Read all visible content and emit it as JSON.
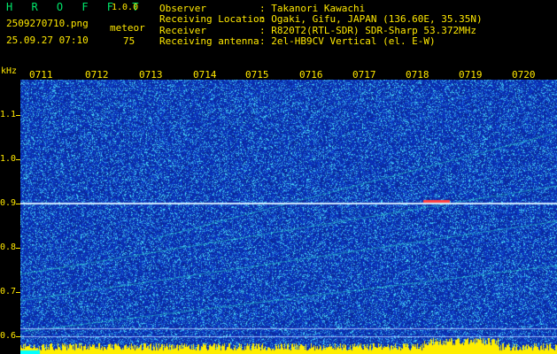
{
  "header": {
    "logo": "H R O F F T",
    "version": "1.0.0",
    "filename": "2509270710.png",
    "datetime": "25.09.27 07:10",
    "meteor_label": "meteor",
    "meteor_count": "75"
  },
  "info": [
    {
      "key": "Observer",
      "value": ": Takanori Kawachi"
    },
    {
      "key": "Receiving Location",
      "value": ": Ogaki, Gifu, JAPAN (136.60E, 35.35N)"
    },
    {
      "key": "Receiver",
      "value": ": R820T2(RTL-SDR) SDR-Sharp 53.372MHz"
    },
    {
      "key": "Receiving antenna",
      "value": ": 2el-HB9CV Vertical (el. E-W)"
    }
  ],
  "axis": {
    "unit": "kHz",
    "time_ticks": [
      "0711",
      "0712",
      "0713",
      "0714",
      "0715",
      "0716",
      "0717",
      "0718",
      "0719",
      "0720"
    ],
    "freq_ticks": [
      "1.1",
      "1.0",
      "0.9",
      "0.8",
      "0.7",
      "0.6"
    ]
  },
  "colors": {
    "text": "#ffe800",
    "logo": "#00e86b",
    "background": "#000000",
    "spectrogram_base": "#0a1a7a",
    "carrier": "#cfe9ff",
    "bottom_band": "#ffee00",
    "bottom_cyan": "#00ffff"
  }
}
